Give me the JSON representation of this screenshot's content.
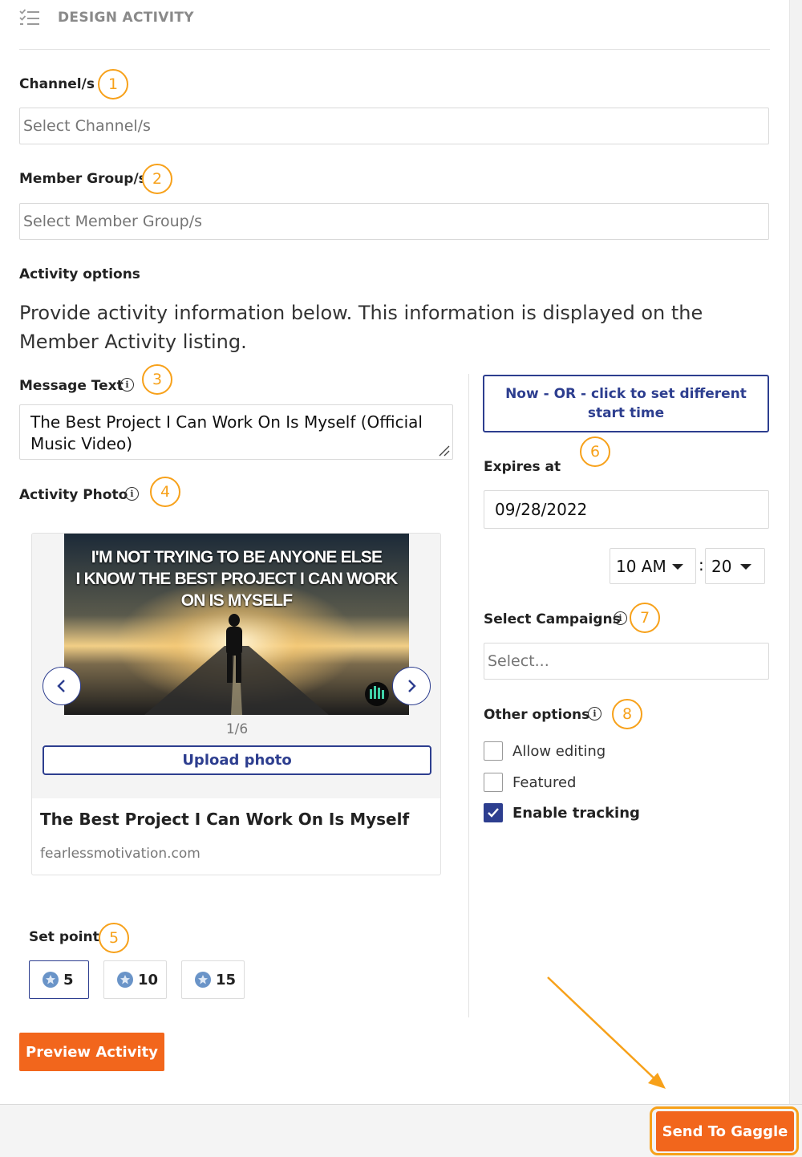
{
  "header": {
    "title": "DESIGN ACTIVITY",
    "icon": "checklist-icon"
  },
  "channels": {
    "label": "Channel/s",
    "placeholder": "Select Channel/s",
    "badge": "1"
  },
  "member_groups": {
    "label": "Member Group/s",
    "placeholder": "Select Member Group/s",
    "badge": "2"
  },
  "activity_options": {
    "heading": "Activity options",
    "description": "Provide activity information below. This information is displayed on the Member Activity listing."
  },
  "message": {
    "label": "Message Text",
    "value": "The Best Project I Can Work On Is Myself (Official Music Video)",
    "badge": "3"
  },
  "photo": {
    "label": "Activity Photo",
    "badge": "4",
    "caption_line1": "I'M NOT TRYING TO BE ANYONE ELSE",
    "caption_line2": "I KNOW THE BEST PROJECT I CAN WORK ON IS MYSELF",
    "counter": "1/6",
    "upload_label": "Upload photo",
    "card_title": "The Best Project I Can Work On Is Myself",
    "card_domain": "fearlessmotivation.com"
  },
  "points": {
    "label": "Set points",
    "badge": "5",
    "options": [
      "5",
      "10",
      "15"
    ],
    "selected": "5"
  },
  "preview_label": "Preview Activity",
  "schedule": {
    "start_label": "Now - OR - click to set different start time",
    "badge": "6",
    "expires_label": "Expires at",
    "expires_date": "09/28/2022",
    "hour": "10 AM",
    "minute": "20",
    "separator": ":"
  },
  "campaigns": {
    "label": "Select Campaigns",
    "placeholder": "Select...",
    "badge": "7"
  },
  "other_options": {
    "label": "Other options",
    "badge": "8",
    "items": [
      {
        "label": "Allow editing",
        "checked": false
      },
      {
        "label": "Featured",
        "checked": false
      },
      {
        "label": "Enable tracking",
        "checked": true
      }
    ]
  },
  "send_label": "Send To Gaggle",
  "colors": {
    "accent_orange": "#f2661c",
    "badge_orange": "#f7a11a",
    "navy": "#2d3e8f"
  }
}
